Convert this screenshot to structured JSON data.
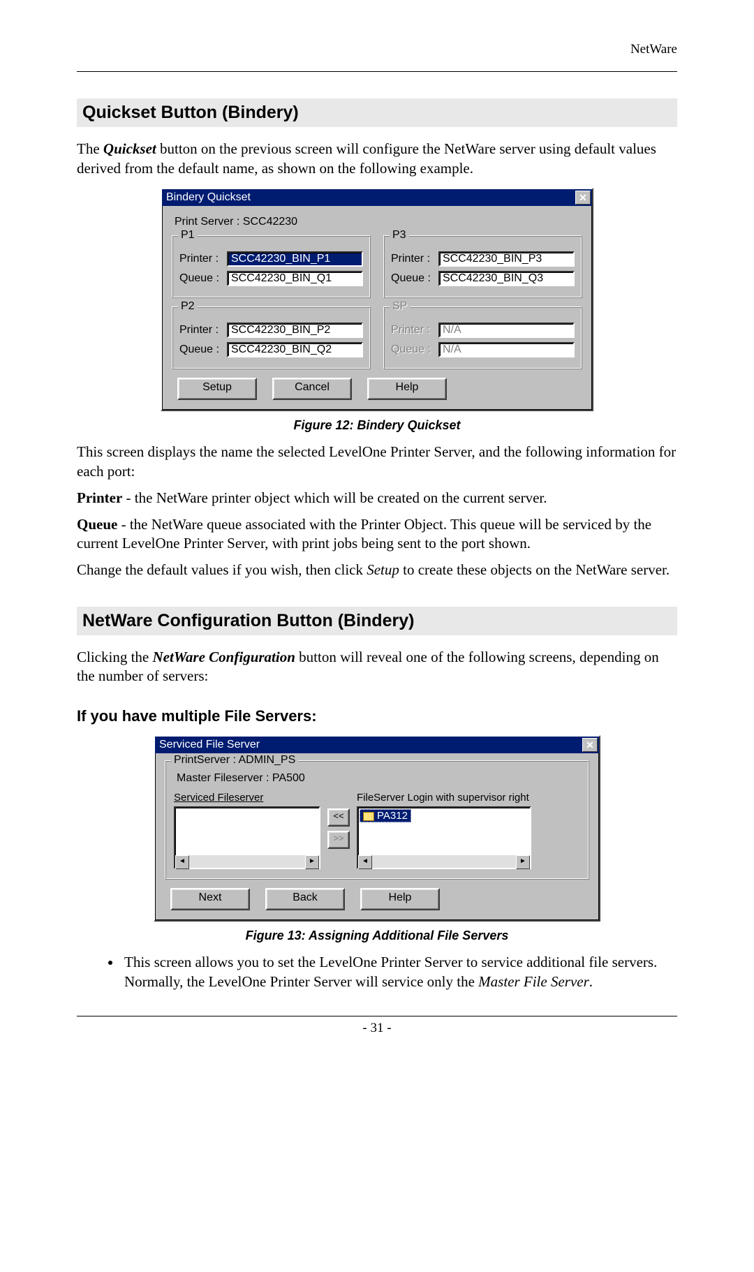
{
  "header": {
    "right": "NetWare"
  },
  "section1": {
    "heading": "Quickset Button (Bindery)",
    "intro_pre": "The ",
    "intro_bolditalic": "Quickset",
    "intro_post": " button on the previous screen will configure the NetWare server using default values derived from the default name, as shown on the following example."
  },
  "dialog1": {
    "title": "Bindery Quickset",
    "print_server_label": "Print Server : SCC42230",
    "groups": {
      "p1": {
        "legend": "P1",
        "printer_label": "Printer :",
        "printer_value": "SCC42230_BIN_P1",
        "queue_label": "Queue :",
        "queue_value": "SCC42230_BIN_Q1"
      },
      "p3": {
        "legend": "P3",
        "printer_label": "Printer :",
        "printer_value": "SCC42230_BIN_P3",
        "queue_label": "Queue :",
        "queue_value": "SCC42230_BIN_Q3"
      },
      "p2": {
        "legend": "P2",
        "printer_label": "Printer :",
        "printer_value": "SCC42230_BIN_P2",
        "queue_label": "Queue :",
        "queue_value": "SCC42230_BIN_Q2"
      },
      "sp": {
        "legend": "SP",
        "printer_label": "Printer :",
        "printer_value": "N/A",
        "queue_label": "Queue :",
        "queue_value": "N/A"
      }
    },
    "buttons": {
      "setup": "Setup",
      "cancel": "Cancel",
      "help": "Help"
    }
  },
  "figure1_caption": "Figure 12: Bindery Quickset",
  "para_after_fig1": "This screen displays the name the selected LevelOne Printer Server, and the following information for each port:",
  "printer_def_label": "Printer",
  "printer_def_text": " - the NetWare printer object which will be created on the current server.",
  "queue_def_label": "Queue",
  "queue_def_text": " - the NetWare queue associated with the Printer Object. This queue will be serviced by the current LevelOne Printer Server, with print jobs being sent to the port shown.",
  "change_defaults_pre": "Change the default values if you wish, then click ",
  "change_defaults_italic": "Setup",
  "change_defaults_post": " to create these objects on the NetWare server.",
  "section2": {
    "heading": "NetWare Configuration Button (Bindery)",
    "intro_pre": "Clicking the ",
    "intro_bolditalic": "NetWare Configuration",
    "intro_post": " button will reveal one of the following screens, depending on the number of servers:",
    "sub": "If you have multiple File Servers:"
  },
  "dialog2": {
    "title": "Serviced File Server",
    "group_legend": "PrintServer : ADMIN_PS",
    "master_line": "Master Fileserver : PA500",
    "left_caption": "Serviced Fileserver",
    "right_caption": "FileServer Login with supervisor right",
    "right_item": "PA312",
    "move_left": "<<",
    "move_right": ">>",
    "buttons": {
      "next": "Next",
      "back": "Back",
      "help": "Help"
    }
  },
  "figure2_caption": "Figure 13: Assigning Additional File Servers",
  "bullet1_pre": "This screen allows you to set the LevelOne Printer Server to service additional file servers. Normally, the LevelOne Printer Server will service only the ",
  "bullet1_italic": "Master File Server",
  "bullet1_post": ".",
  "page_number": "- 31 -"
}
